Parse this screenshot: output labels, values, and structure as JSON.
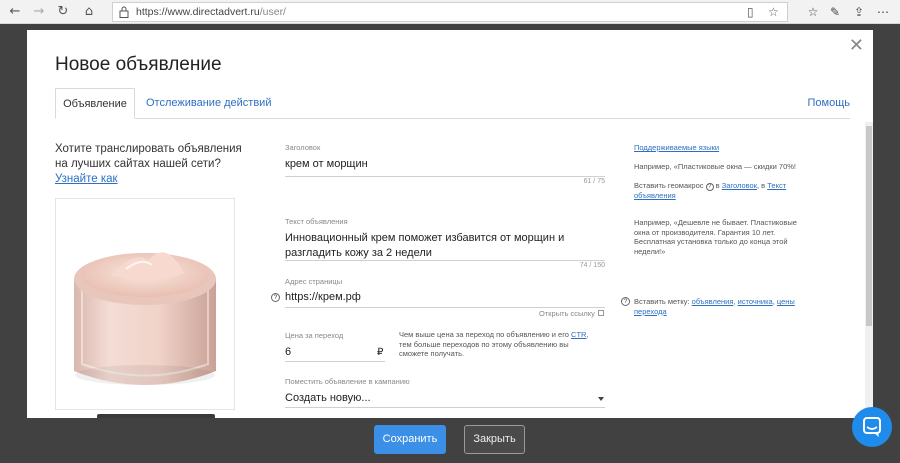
{
  "browser": {
    "url_host": "https://www.directadvert.ru",
    "url_path": "/user/"
  },
  "modal": {
    "title": "Новое объявление",
    "tabs": [
      {
        "label": "Объявление"
      },
      {
        "label": "Отслеживание действий"
      }
    ],
    "help": "Помощь"
  },
  "promo": {
    "text_line1": "Хотите транслировать объявления",
    "text_line2": "на лучших сайтах нашей сети?",
    "link": "Узнайте как"
  },
  "form": {
    "headline": {
      "label": "Заголовок",
      "value": "крем от морщин",
      "counter": "61 / 75"
    },
    "body": {
      "label": "Текст объявления",
      "value_line1": "Инновационный крем поможет избавится от морщин и",
      "value_line2": "разгладить кожу за 2 недели",
      "counter": "74 / 150"
    },
    "url": {
      "label": "Адрес страницы",
      "value": "https://крем.рф",
      "open_link": "Открыть ссылку"
    },
    "price": {
      "label": "Цена за переход",
      "value": "6",
      "currency": "₽",
      "note_line1_prefix": "Чем выше цена за переход по объявлению и его ",
      "note_ctr": "CTR",
      "note_line1_suffix": ",",
      "note_line2": "тем больше переходов по этому объявлению вы",
      "note_line3": "сможете получать."
    },
    "campaign": {
      "label": "Поместить объявление в кампанию",
      "value": "Создать новую..."
    }
  },
  "right": {
    "languages_link": "Поддерживаемые языки",
    "example1": "Например, «Пластиковые окна — скидки 70%!",
    "geo_prefix": "Вставить геомакрос ",
    "geo_in": " в ",
    "geo_headline": "Заголовок",
    "geo_or": ", в ",
    "geo_text1": "Текст",
    "geo_text2": "объявления",
    "example2_line1": "Например, «Дешевле не бывает. Пластиковые",
    "example2_line2": "окна от производителя. Гарантия 10 лет.",
    "example2_line3": "Бесплатная установка только до конца этой",
    "example2_line4": "недели!»",
    "tags_prefix": "Вставить метку: ",
    "tag_ads": "объявления",
    "tag_sep1": ", ",
    "tag_sources": "источника",
    "tag_sep2": ", ",
    "tag_price1": "цены",
    "tag_price2": "перехода"
  },
  "footer": {
    "save": "Сохранить",
    "close": "Закрыть"
  },
  "colors": {
    "accent": "#3b8fe6",
    "link": "#2d6fc2",
    "chat": "#1f8ceb",
    "overlay": "#414141"
  }
}
